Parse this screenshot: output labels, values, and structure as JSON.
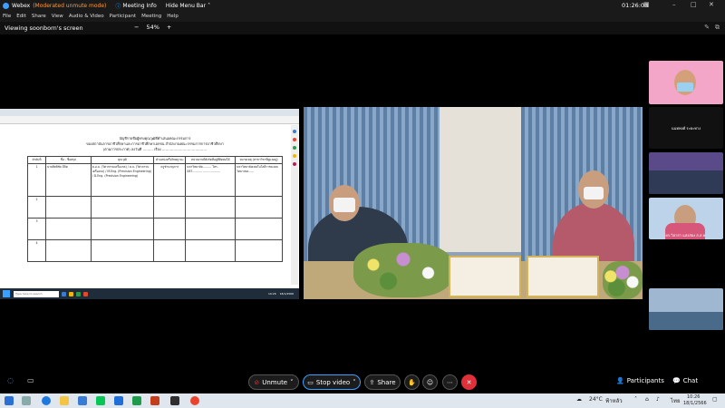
{
  "window": {
    "app_name": "Webex",
    "mode": "(Moderated unmute mode)",
    "meeting_info": "Meeting Info",
    "hide_menu": "Hide Menu Bar",
    "clock": "01:26:03"
  },
  "menu": [
    "File",
    "Edit",
    "Share",
    "View",
    "Audio & Video",
    "Participant",
    "Meeting",
    "Help"
  ],
  "share": {
    "viewing": "Viewing soonborn's screen",
    "zoom_minus": "−",
    "zoom_level": "54%",
    "zoom_plus": "+"
  },
  "document": {
    "title_line1": "บัญชีรายชื่อผู้ทรงคุณวุฒิที่คำเสนอคณะกรรมการ",
    "title_line2": "ของสถาบันการอาชีวศึกษาและการอาชีวศึกษาเอกชน สำนักงานคณะกรรมการการอาชีวศึกษา",
    "title_line3": "(ตามการประกาศ) ลงวันที่ ……… เรื่อง …………………………………",
    "columns": [
      "ลำดับที่",
      "ชื่อ - ชื่อสกุล",
      "คุณวุฒิ",
      "ตำแหน่งหรือวิทยฐานะ",
      "หน่วยงานที่สังกัดที่อยู่ที่ติดต่อได้",
      "หมายเหตุ (สาขาวิชาที่ดูแลอยู่)"
    ],
    "rows": [
      {
        "no": "1",
        "name": "นายสิทธิชัย มีจิต",
        "qual": "ค.อ.ม. (วิศวกรรมเครื่องกล) / ค.บ. (วิศวกรรมเครื่องกล) / M.Eng. (Precision Engineering) / D.Eng. (Precision Engineering)",
        "pos": "ครูชำนาญการ",
        "addr": "มหาวิทยาลัย……… โทร. 087-……… ………………",
        "note": "มหาวิทยาลัยเทคโนโลยีราชมงคล วิทยาเขต……"
      },
      {
        "no": "2",
        "name": "",
        "qual": "",
        "pos": "",
        "addr": "",
        "note": ""
      },
      {
        "no": "3",
        "name": "",
        "qual": "",
        "pos": "",
        "addr": "",
        "note": ""
      },
      {
        "no": "4",
        "name": "",
        "qual": "",
        "pos": "",
        "addr": "",
        "note": ""
      }
    ]
  },
  "remote_taskbar": {
    "search": "Type here to search",
    "time": "10:26",
    "date": "18/1/2566"
  },
  "participants": [
    {
      "name": "",
      "bg": "#f4a6c9"
    },
    {
      "name": "นนทพงศ์ ระยะทาง",
      "bg": "#111111"
    },
    {
      "name": "",
      "bg": "#5a4a8a"
    },
    {
      "name": "ดร.วิลาสา แสงส่อง ส.ส.ค.",
      "bg": "#bcd3ea"
    },
    {
      "name": "",
      "bg": "#000000"
    },
    {
      "name": "",
      "bg": "#9fb7d0"
    }
  ],
  "controls": {
    "unmute": "Unmute",
    "stop_video": "Stop video",
    "share": "Share",
    "participants": "Participants",
    "chat": "Chat"
  },
  "taskbar": {
    "weather": "24°C",
    "weather_desc": "ฟ้าหลัว",
    "lang": "ไทย",
    "time": "10:26",
    "date": "18/1/2566"
  },
  "colors": {
    "leave": "#e0303a",
    "mod_mode": "#ff9a3a",
    "accent": "#3aa0ff"
  }
}
